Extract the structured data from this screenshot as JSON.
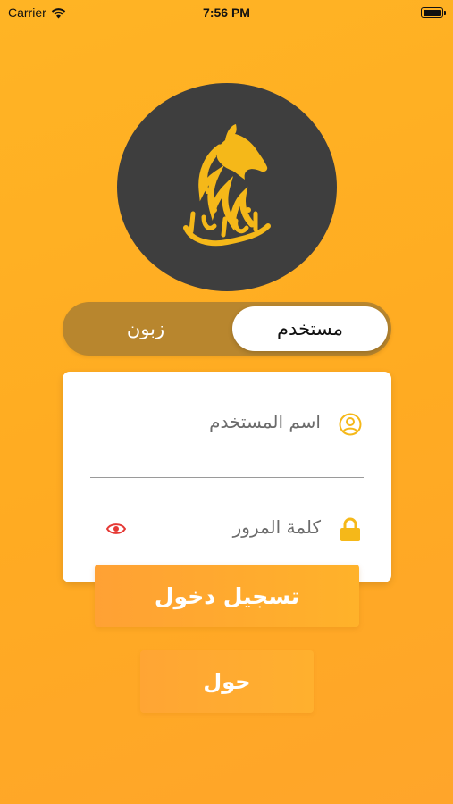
{
  "status_bar": {
    "carrier": "Carrier",
    "time": "7:56 PM",
    "wifi_icon": "wifi-icon",
    "battery_icon": "battery-icon",
    "battery_level": 1.0
  },
  "logo": {
    "icon": "horse-head-logo",
    "text": "الفارس",
    "circle_color": "#3E3E3E",
    "logo_color": "#F5B819"
  },
  "role_toggle": {
    "selected": "مستخدم",
    "options": [
      "مستخدم",
      "زبون"
    ],
    "active_label": "مستخدم",
    "inactive_label": "زبون"
  },
  "login_form": {
    "username": {
      "placeholder": "اسم المستخدم",
      "value": "",
      "icon": "user-circle-icon"
    },
    "password": {
      "placeholder": "كلمة المرور",
      "value": "",
      "icon": "lock-icon",
      "toggle_icon": "eye-icon"
    }
  },
  "buttons": {
    "login": "تسجيل دخول",
    "about": "حول"
  },
  "colors": {
    "background": "#FFB024",
    "accent": "#F5B819",
    "toggle_track": "#B8862E",
    "eye_icon": "#E53935"
  }
}
